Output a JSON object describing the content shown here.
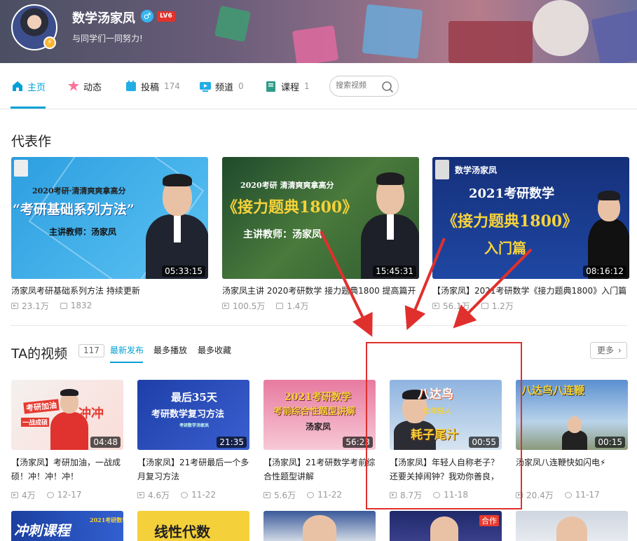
{
  "profile": {
    "name": "数学汤家凤",
    "gender_symbol": "♂",
    "level": "LV6",
    "sign": "与同学们一同努力!",
    "badge_icon": "⚡"
  },
  "nav": {
    "items": [
      {
        "label": "主页",
        "count": "",
        "icon": "home-icon"
      },
      {
        "label": "动态",
        "count": "",
        "icon": "dynamic-icon"
      },
      {
        "label": "投稿",
        "count": "174",
        "icon": "upload-icon"
      },
      {
        "label": "频道",
        "count": "0",
        "icon": "channel-icon"
      },
      {
        "label": "课程",
        "count": "1",
        "icon": "course-icon"
      }
    ],
    "search_placeholder": "搜索视频"
  },
  "masterpiece": {
    "title": "代表作",
    "cards": [
      {
        "duration": "05:33:15",
        "title": "汤家凤考研基础系列方法 持续更新",
        "plays": "23.1万",
        "danmaku": "1832",
        "thumb_line1": "2020考研·清清爽爽拿高分",
        "thumb_line2": "“考研基础系列方法”",
        "thumb_line3": "主讲教师：汤家凤"
      },
      {
        "duration": "15:45:31",
        "title": "汤家凤主讲 2020考研数学 接力题典1800 提高篇开",
        "plays": "100.5万",
        "danmaku": "1.4万",
        "thumb_line1": "2020考研 清清爽爽拿高分",
        "thumb_line2": "《接力题典1800》",
        "thumb_line3": "主讲教师：汤家凤"
      },
      {
        "duration": "08:16:12",
        "title": "【汤家凤】2021考研数学《接力题典1800》入门篇",
        "plays": "56.1万",
        "danmaku": "1.2万",
        "thumb_line0": "数学汤家凤",
        "thumb_line1": "2021考研数学",
        "thumb_line2": "《接力题典1800》",
        "thumb_line3": "入门篇"
      }
    ]
  },
  "videos": {
    "title": "TA的视频",
    "count": "117",
    "tabs": [
      "最新发布",
      "最多播放",
      "最多收藏"
    ],
    "more": "更多",
    "cards": [
      {
        "duration": "04:48",
        "title": "【汤家凤】考研加油，一战成硕！冲！冲！冲！",
        "plays": "4万",
        "date": "12-17",
        "thumb_a": "考研加油",
        "thumb_b": "冲冲",
        "thumb_c": "一战成硕"
      },
      {
        "duration": "21:35",
        "title": "【汤家凤】21考研最后一个多月复习方法",
        "plays": "4.6万",
        "date": "11-22",
        "thumb_a": "最后35天",
        "thumb_b": "考研数学复习方法",
        "thumb_c": "考研数学汤家凤"
      },
      {
        "duration": "56:23",
        "title": "【汤家凤】21考研数学考前综合性题型讲解",
        "plays": "5.6万",
        "date": "11-22",
        "thumb_a": "2021考研数学",
        "thumb_b": "考前综合性题型讲解",
        "thumb_c": "汤家凤"
      },
      {
        "duration": "00:55",
        "title": "【汤家凤】年轻人自称老子？还要关掉闹钟？我劝你善良，",
        "plays": "8.7万",
        "date": "11-18",
        "thumb_a": "八达鸟",
        "thumb_b": "耗子尾汁",
        "thumb_c": "劝年轻人"
      },
      {
        "duration": "00:15",
        "title": "汤家凤八连鞭快如闪电⚡",
        "plays": "20.4万",
        "date": "11-17",
        "thumb_a": "八达鸟八连鞭",
        "thumb_b": "",
        "thumb_c": ""
      }
    ],
    "row3": [
      {
        "thumb_a": "冲刺课程",
        "thumb_b": "2021考研数学"
      },
      {
        "thumb_a": "线性代数",
        "thumb_b": ""
      },
      {
        "thumb_a": "",
        "thumb_b": ""
      },
      {
        "thumb_a": "",
        "thumb_b": "合作"
      },
      {
        "thumb_a": "",
        "thumb_b": ""
      }
    ]
  },
  "colors": {
    "accent": "#00a1d6",
    "annotation_red": "#e0302d",
    "level_badge": "#e2322c"
  }
}
